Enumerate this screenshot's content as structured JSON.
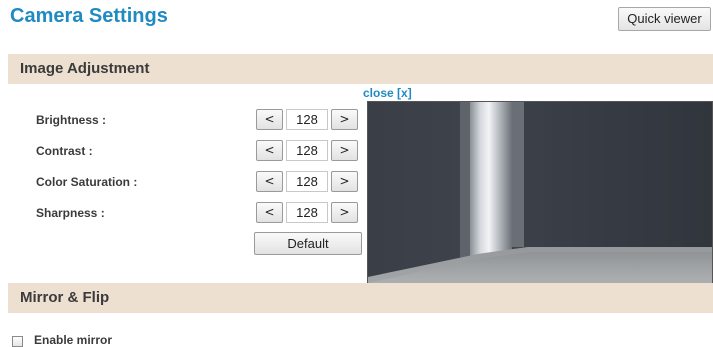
{
  "header": {
    "title": "Camera Settings",
    "quick_viewer_label": "Quick viewer"
  },
  "image_adjustment": {
    "section_title": "Image Adjustment",
    "close_label": "close [x]",
    "decrement_label": "<",
    "increment_label": ">",
    "controls": [
      {
        "label": "Brightness :",
        "value": "128"
      },
      {
        "label": "Contrast :",
        "value": "128"
      },
      {
        "label": "Color Saturation :",
        "value": "128"
      },
      {
        "label": "Sharpness :",
        "value": "128"
      }
    ],
    "default_label": "Default"
  },
  "mirror_flip": {
    "section_title": "Mirror & Flip",
    "enable_mirror_label": "Enable mirror",
    "enable_mirror_checked": false
  },
  "colors": {
    "accent": "#1e8bc3",
    "section_header_bg": "#ede0d1",
    "label_text": "#3b3b3b"
  }
}
